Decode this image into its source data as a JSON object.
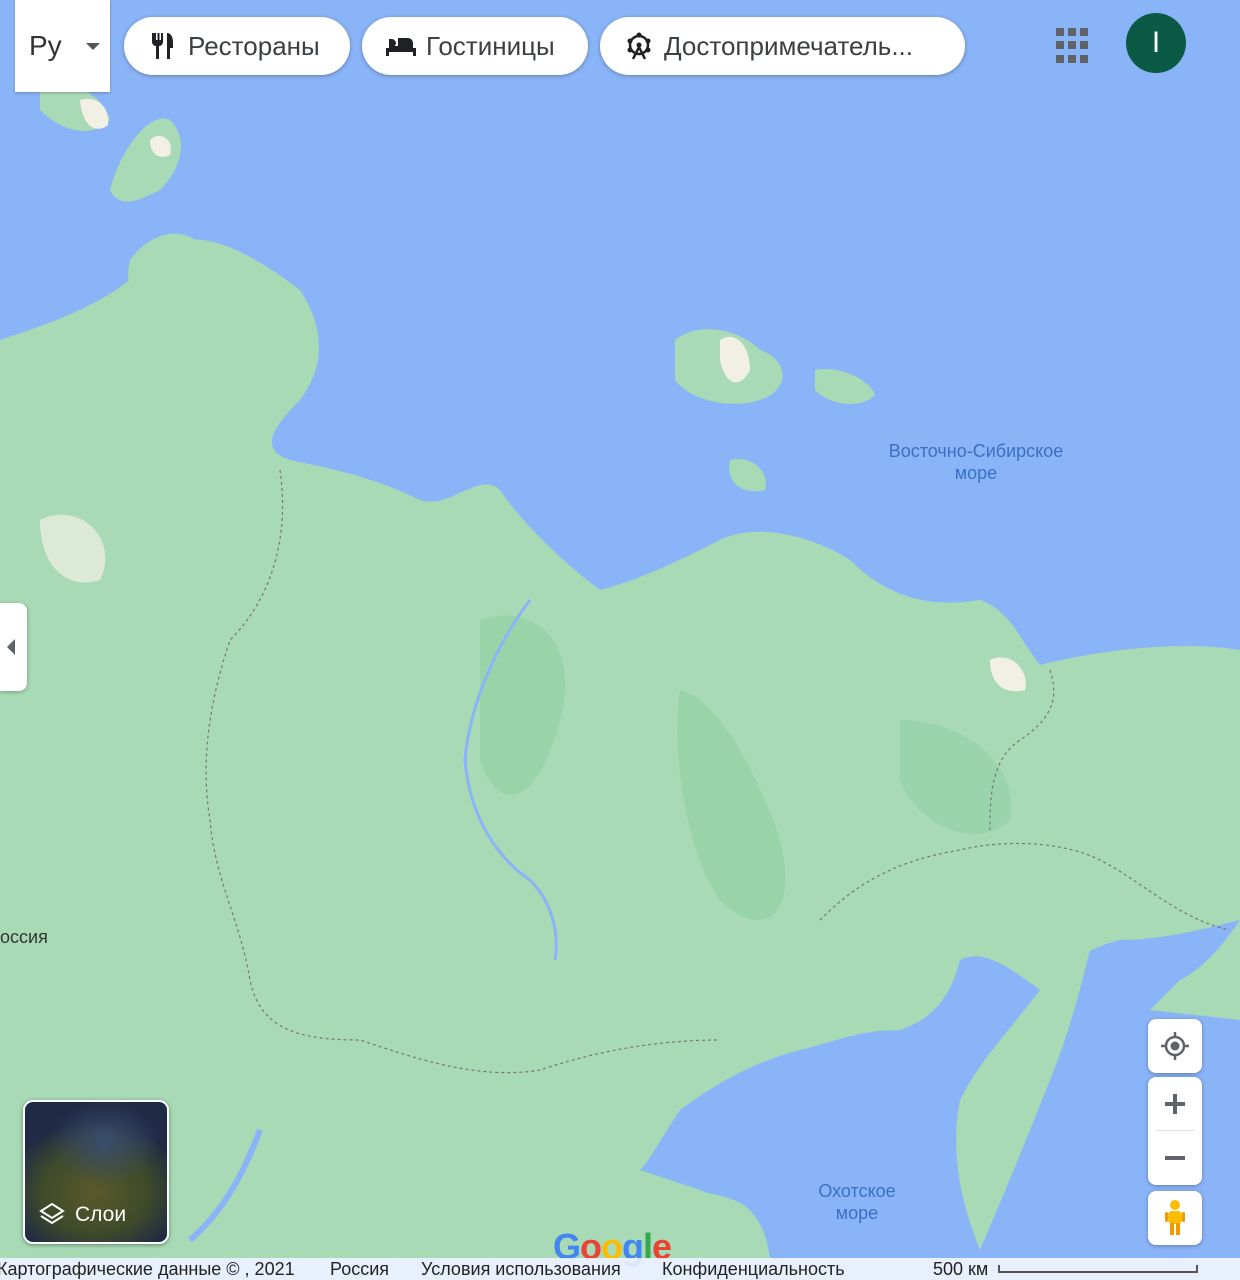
{
  "language": {
    "code": "Ру"
  },
  "chips": [
    {
      "label": "Рестораны",
      "icon": "fork-knife-icon"
    },
    {
      "label": "Гостиницы",
      "icon": "bed-icon"
    },
    {
      "label": "Достопримечатель...",
      "icon": "ferris-wheel-icon"
    }
  ],
  "account": {
    "initial": "I"
  },
  "map_labels": {
    "east_siberian_sea": "Восточно-Сибирское\nморе",
    "okhotsk_sea": "Охотское\nморе",
    "russia": "оссия"
  },
  "layers": {
    "label": "Слои"
  },
  "logo": {
    "text": "Google"
  },
  "footer": {
    "copyright": "Картографические данные © , 2021",
    "country": "Россия",
    "terms": "Условия использования",
    "privacy": "Конфиденциальность",
    "scale": "500 км"
  },
  "colors": {
    "water": "#8ab4f8",
    "land": "#a8dab5",
    "land_dark": "#94d2a5",
    "snow": "#f2efe5",
    "accent": "#1a73e8"
  }
}
